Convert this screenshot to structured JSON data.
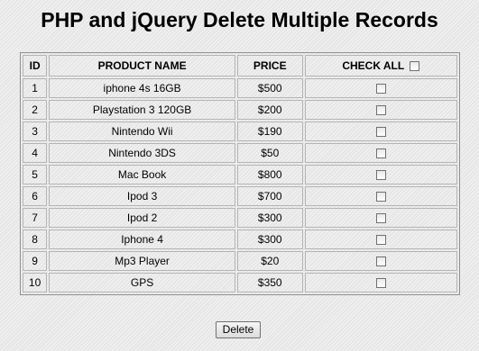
{
  "page": {
    "title": "PHP and jQuery Delete Multiple Records"
  },
  "table": {
    "headers": {
      "id": "ID",
      "product_name": "PRODUCT NAME",
      "price": "PRICE",
      "check_all": "CHECK ALL"
    },
    "rows": [
      {
        "id": "1",
        "name": "iphone 4s 16GB",
        "price": "$500",
        "checked": false
      },
      {
        "id": "2",
        "name": "Playstation 3 120GB",
        "price": "$200",
        "checked": false
      },
      {
        "id": "3",
        "name": "Nintendo Wii",
        "price": "$190",
        "checked": false
      },
      {
        "id": "4",
        "name": "Nintendo 3DS",
        "price": "$50",
        "checked": false
      },
      {
        "id": "5",
        "name": "Mac Book",
        "price": "$800",
        "checked": false
      },
      {
        "id": "6",
        "name": "Ipod 3",
        "price": "$700",
        "checked": false
      },
      {
        "id": "7",
        "name": "Ipod 2",
        "price": "$300",
        "checked": false
      },
      {
        "id": "8",
        "name": "Iphone 4",
        "price": "$300",
        "checked": false
      },
      {
        "id": "9",
        "name": "Mp3 Player",
        "price": "$20",
        "checked": false
      },
      {
        "id": "10",
        "name": "GPS",
        "price": "$350",
        "checked": false
      }
    ]
  },
  "actions": {
    "delete_label": "Delete"
  }
}
